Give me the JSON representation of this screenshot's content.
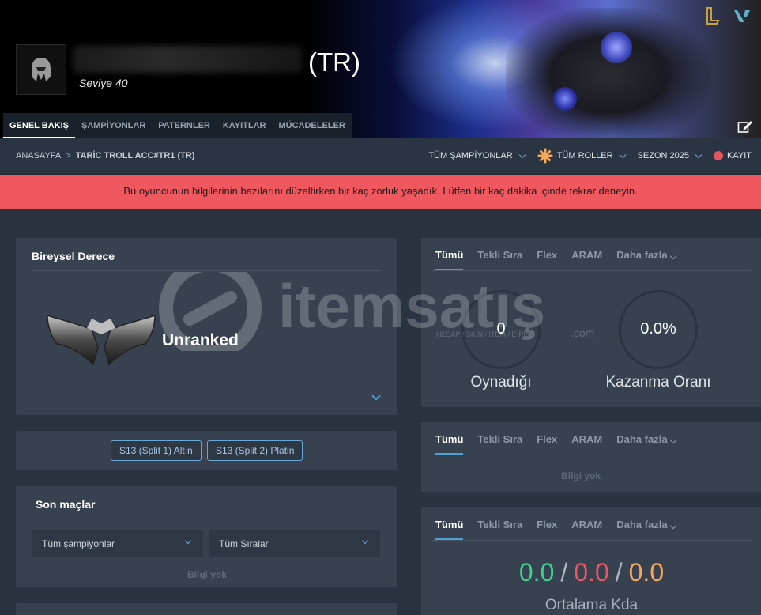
{
  "header": {
    "player_region": "(TR)",
    "level": "Seviye 40",
    "tabs": [
      "GENEL BAKIŞ",
      "ŞAMPİYONLAR",
      "PATERNLER",
      "KAYITLAR",
      "MÜCADELELER"
    ]
  },
  "filterbar": {
    "breadcrumb_home": "ANASAYFA",
    "breadcrumb_sep": ">",
    "breadcrumb_current": "TARİC TROLL ACC#TR1 (TR)",
    "champions": "TÜM ŞAMPİYONLAR",
    "roles": "TÜM ROLLER",
    "season": "SEZON 2025",
    "record": "KAYIT"
  },
  "alert": "Bu oyuncunun bilgilerinin bazılarını düzeltirken bir kaç zorluk yaşadık. Lütfen bir kaç dakika içinde tekrar deneyin.",
  "rank_card": {
    "title": "Bireysel Derece",
    "rank": "Unranked"
  },
  "seasons": [
    "S13 (Split 1) Altın",
    "S13 (Split 2) Platin"
  ],
  "recent": {
    "title": "Son maçlar",
    "champion_select": "Tüm şampiyonlar",
    "queue_select": "Tüm Sıralar",
    "no_info": "Bilgi yok"
  },
  "queue_tabs": [
    "Tümü",
    "Tekli Sıra",
    "Flex",
    "ARAM",
    "Daha fazla"
  ],
  "stats": {
    "played_value": "0",
    "played_label": "Oynadığı",
    "winrate_value": "0.0%",
    "winrate_label": "Kazanma Oranı"
  },
  "champ_card": {
    "no_info": "Bilgi yok"
  },
  "kda": {
    "kills": "0.0",
    "deaths": "0.0",
    "assists": "0.0",
    "sep": "/",
    "label": "Ortalama Kda"
  },
  "watermark": {
    "brand": "itemsatış",
    "tagline": "HESAP / SKIN / ITEM / E-PIN",
    "domain": ".com"
  },
  "colors": {
    "accent": "#4e9fd4",
    "alert": "#f0585f",
    "kills": "#3fd08f",
    "deaths": "#ef5561",
    "assists": "#f6a95a"
  }
}
